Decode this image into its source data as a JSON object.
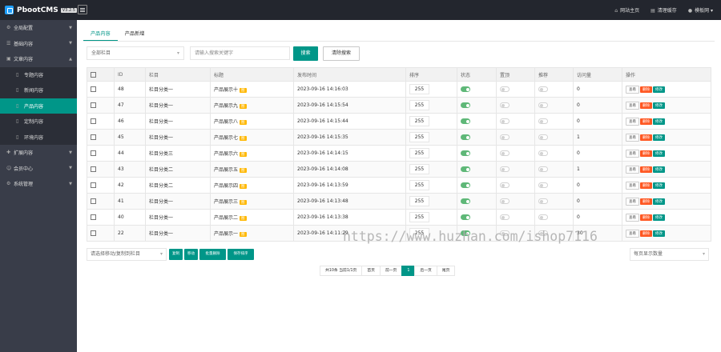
{
  "brand": {
    "name": "PbootCMS",
    "version": "V3.2.5"
  },
  "top_links": [
    {
      "icon": "home-icon",
      "label": "网站主页"
    },
    {
      "icon": "trash-icon",
      "label": "清理缓存"
    },
    {
      "icon": "user-icon",
      "label": "模板网"
    }
  ],
  "sidebar": {
    "items": [
      {
        "label": "全局配置",
        "icon": "gear-icon",
        "expanded": false
      },
      {
        "label": "基础内容",
        "icon": "list-icon",
        "expanded": false
      },
      {
        "label": "文章内容",
        "icon": "doc-icon",
        "expanded": true
      },
      {
        "label": "扩展内容",
        "icon": "puzzle-icon",
        "expanded": false
      },
      {
        "label": "会员中心",
        "icon": "user-icon",
        "expanded": false
      },
      {
        "label": "系统管理",
        "icon": "gear-icon",
        "expanded": false
      }
    ],
    "sub_items": [
      {
        "label": "专题内容"
      },
      {
        "label": "新闻内容"
      },
      {
        "label": "产品内容"
      },
      {
        "label": "定制内容"
      },
      {
        "label": "环境内容"
      }
    ]
  },
  "tabs": [
    "产品内容",
    "产品新增"
  ],
  "filter": {
    "category": "全部栏目",
    "keyword_placeholder": "请输入搜索关键字",
    "search": "搜索",
    "clear": "清除搜索"
  },
  "table": {
    "headers": [
      "",
      "ID",
      "栏目",
      "标题",
      "发布时间",
      "排序",
      "状态",
      "置顶",
      "推荐",
      "访问量",
      "操作"
    ],
    "rows": [
      {
        "id": "48",
        "cat": "栏目分类一",
        "title": "产品展示十",
        "date": "2023-09-16 14:16:03",
        "sort": "255",
        "views": "0"
      },
      {
        "id": "47",
        "cat": "栏目分类一",
        "title": "产品展示九",
        "date": "2023-09-16 14:15:54",
        "sort": "255",
        "views": "0"
      },
      {
        "id": "46",
        "cat": "栏目分类一",
        "title": "产品展示八",
        "date": "2023-09-16 14:15:44",
        "sort": "255",
        "views": "0"
      },
      {
        "id": "45",
        "cat": "栏目分类一",
        "title": "产品展示七",
        "date": "2023-09-16 14:15:35",
        "sort": "255",
        "views": "1"
      },
      {
        "id": "44",
        "cat": "栏目分类三",
        "title": "产品展示六",
        "date": "2023-09-16 14:14:15",
        "sort": "255",
        "views": "0"
      },
      {
        "id": "43",
        "cat": "栏目分类二",
        "title": "产品展示五",
        "date": "2023-09-16 14:14:08",
        "sort": "255",
        "views": "1"
      },
      {
        "id": "42",
        "cat": "栏目分类二",
        "title": "产品展示四",
        "date": "2023-09-16 14:13:59",
        "sort": "255",
        "views": "0"
      },
      {
        "id": "41",
        "cat": "栏目分类一",
        "title": "产品展示三",
        "date": "2023-09-16 14:13:48",
        "sort": "255",
        "views": "0"
      },
      {
        "id": "40",
        "cat": "栏目分类一",
        "title": "产品展示二",
        "date": "2023-09-16 14:13:38",
        "sort": "255",
        "views": "0"
      },
      {
        "id": "22",
        "cat": "栏目分类一",
        "title": "产品展示一",
        "date": "2023-09-16 14:11:29",
        "sort": "255",
        "views": "30"
      }
    ],
    "tag": "图",
    "ops": [
      "查看",
      "删除",
      "修改"
    ]
  },
  "bottom": {
    "move_placeholder": "请选择移动/复制到栏目",
    "buttons": [
      "复制",
      "移动",
      "批量删除",
      "保存排序"
    ],
    "page_size": "每页显示数量"
  },
  "pager": {
    "summary": "共10条 当前1/1页",
    "first": "首页",
    "prev": "前一页",
    "current": "1",
    "next": "后一页",
    "last": "尾页"
  },
  "watermark": "https://www.huzhan.com/ishop7116",
  "colors": {
    "accent": "#009688",
    "danger": "#ff5722",
    "tag": "#ffb800",
    "sidebar": "#393d49",
    "topbar": "#23262e"
  }
}
